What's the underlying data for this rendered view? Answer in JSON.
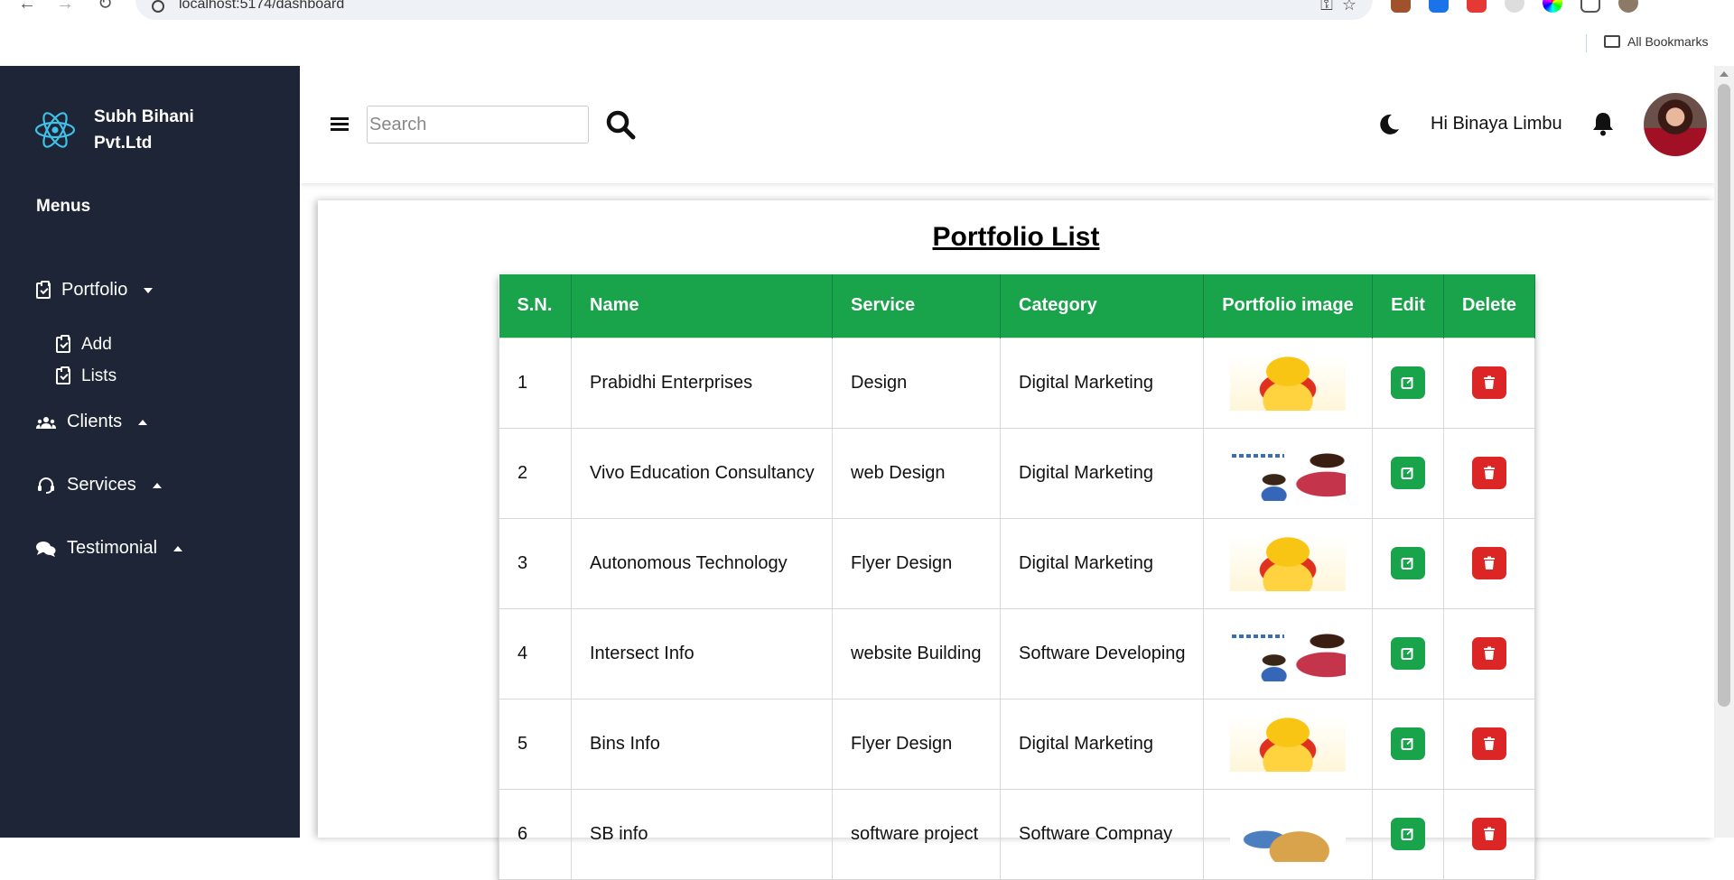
{
  "browser": {
    "url": "localhost:5174/dashboard",
    "bookmarks_label": "All Bookmarks"
  },
  "sidebar": {
    "brand": "Subh Bihani Pvt.Ltd",
    "menus_title": "Menus",
    "items": [
      {
        "label": "Portfolio",
        "icon": "clipboard-icon",
        "expanded": true
      },
      {
        "label": "Clients",
        "icon": "users-icon",
        "expanded": false
      },
      {
        "label": "Services",
        "icon": "headset-icon",
        "expanded": false
      },
      {
        "label": "Testimonial",
        "icon": "comments-icon",
        "expanded": false
      }
    ],
    "portfolio_sub": [
      {
        "label": "Add"
      },
      {
        "label": "Lists"
      }
    ]
  },
  "header": {
    "search_placeholder": "Search",
    "greeting": "Hi Binaya Limbu"
  },
  "main": {
    "title": "Portfolio List",
    "columns": [
      "S.N.",
      "Name",
      "Service",
      "Category",
      "Portfolio image",
      "Edit",
      "Delete"
    ],
    "rows": [
      {
        "sn": "1",
        "name": "Prabidhi Enterprises",
        "service": "Design",
        "category": "Digital Marketing",
        "image": "lotus-goddess-image"
      },
      {
        "sn": "2",
        "name": "Vivo Education Consultancy",
        "service": "web Design",
        "category": "Digital Marketing",
        "image": "children-tika-image"
      },
      {
        "sn": "3",
        "name": "Autonomous Technology",
        "service": "Flyer Design",
        "category": "Digital Marketing",
        "image": "lotus-goddess-image"
      },
      {
        "sn": "4",
        "name": "Intersect Info",
        "service": "website Building",
        "category": "Software Developing",
        "image": "children-tika-image"
      },
      {
        "sn": "5",
        "name": "Bins Info",
        "service": "Flyer Design",
        "category": "Digital Marketing",
        "image": "lotus-goddess-image"
      },
      {
        "sn": "6",
        "name": "SB info",
        "service": "software project",
        "category": "Software Compnay",
        "image": "krishna-flute-image"
      }
    ]
  },
  "colors": {
    "sidebar_bg": "#1e2536",
    "table_header": "#19a34a",
    "edit_button": "#19a34a",
    "delete_button": "#dc2626",
    "brand_logo": "#3fc1e8"
  }
}
